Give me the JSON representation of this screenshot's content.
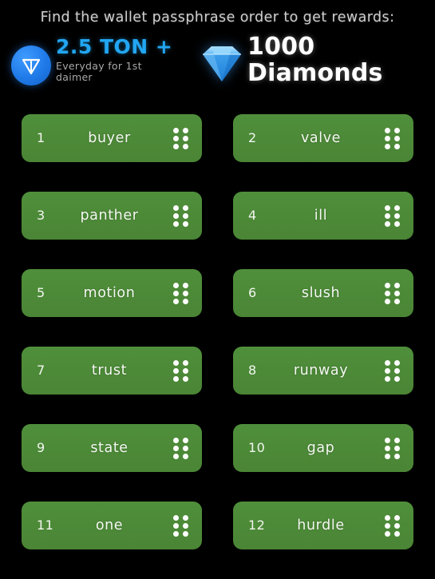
{
  "header": {
    "headline": "Find the wallet passphrase order to get rewards:",
    "ton_reward": {
      "amount": "2.5 TON +",
      "subtitle": "Everyday for 1st daimer",
      "icon": "ton-coin-icon",
      "color": "#22a6f2"
    },
    "diamond_reward": {
      "amount": "1000",
      "label": "Diamonds",
      "icon": "diamond-gem-icon",
      "color": "#ffffff"
    }
  },
  "theme": {
    "background": "#000000",
    "button_green": "#4d8b36",
    "headline_color": "#cfcfcf",
    "handle_dot_color": "#ffffff"
  },
  "word_grid": {
    "drag_handle_icon": "drag-handle-dots-icon",
    "rows": [
      {
        "left": {
          "index": "1",
          "word": "buyer"
        },
        "right": {
          "index": "2",
          "word": "valve"
        }
      },
      {
        "left": {
          "index": "3",
          "word": "panther"
        },
        "right": {
          "index": "4",
          "word": "ill"
        }
      },
      {
        "left": {
          "index": "5",
          "word": "motion"
        },
        "right": {
          "index": "6",
          "word": "slush"
        }
      },
      {
        "left": {
          "index": "7",
          "word": "trust"
        },
        "right": {
          "index": "8",
          "word": "runway"
        }
      },
      {
        "left": {
          "index": "9",
          "word": "state"
        },
        "right": {
          "index": "10",
          "word": "gap"
        }
      },
      {
        "left": {
          "index": "11",
          "word": "one"
        },
        "right": {
          "index": "12",
          "word": "hurdle"
        }
      }
    ]
  }
}
